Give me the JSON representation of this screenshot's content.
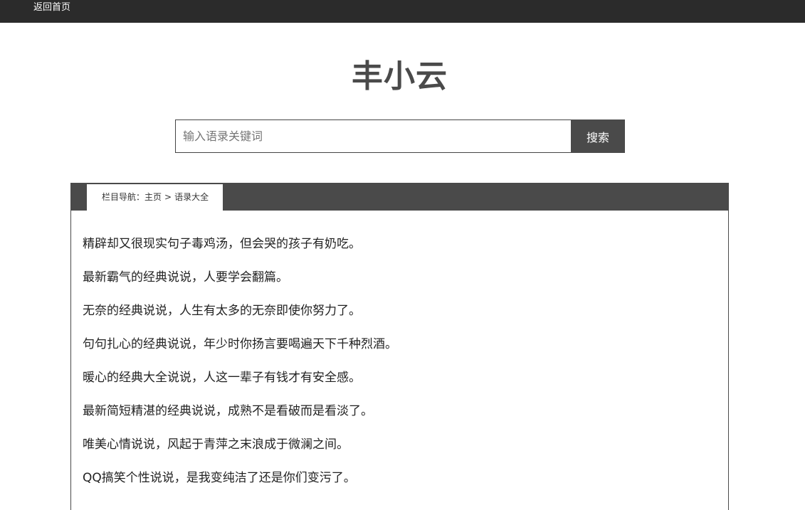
{
  "topbar": {
    "home_label": "返回首页"
  },
  "site": {
    "title": "丰小云"
  },
  "search": {
    "placeholder": "输入语录关键词",
    "value": "",
    "button_label": "搜索"
  },
  "breadcrumb": {
    "prefix": "栏目导航：",
    "home": "主页",
    "separator": ">",
    "current": "语录大全"
  },
  "quotes": [
    "精辟却又很现实句子毒鸡汤，但会哭的孩子有奶吃。",
    "最新霸气的经典说说，人要学会翻篇。",
    "无奈的经典说说，人生有太多的无奈即使你努力了。",
    "句句扎心的经典说说，年少时你扬言要喝遍天下千种烈酒。",
    "暖心的经典大全说说，人这一辈子有钱才有安全感。",
    "最新简短精湛的经典说说，成熟不是看破而是看淡了。",
    "唯美心情说说，风起于青萍之末浪成于微澜之间。",
    "QQ搞笑个性说说，是我变纯洁了还是你们变污了。"
  ],
  "colors": {
    "topbar_bg": "#2b2b2b",
    "accent_dark": "#4a4a4a",
    "text": "#222222"
  }
}
